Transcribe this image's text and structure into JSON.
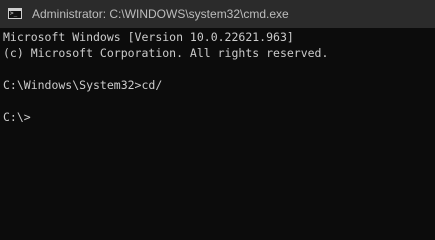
{
  "window": {
    "title": "Administrator: C:\\WINDOWS\\system32\\cmd.exe",
    "icon": "cmd-app-icon"
  },
  "console": {
    "lines": [
      "Microsoft Windows [Version 10.0.22621.963]",
      "(c) Microsoft Corporation. All rights reserved.",
      "C:\\Windows\\System32>cd/",
      "C:\\>"
    ]
  },
  "colors": {
    "titlebar_bg": "#2b2b2b",
    "console_bg": "#0c0c0c",
    "console_text": "#cccccc",
    "title_text": "#bdbdbd"
  }
}
